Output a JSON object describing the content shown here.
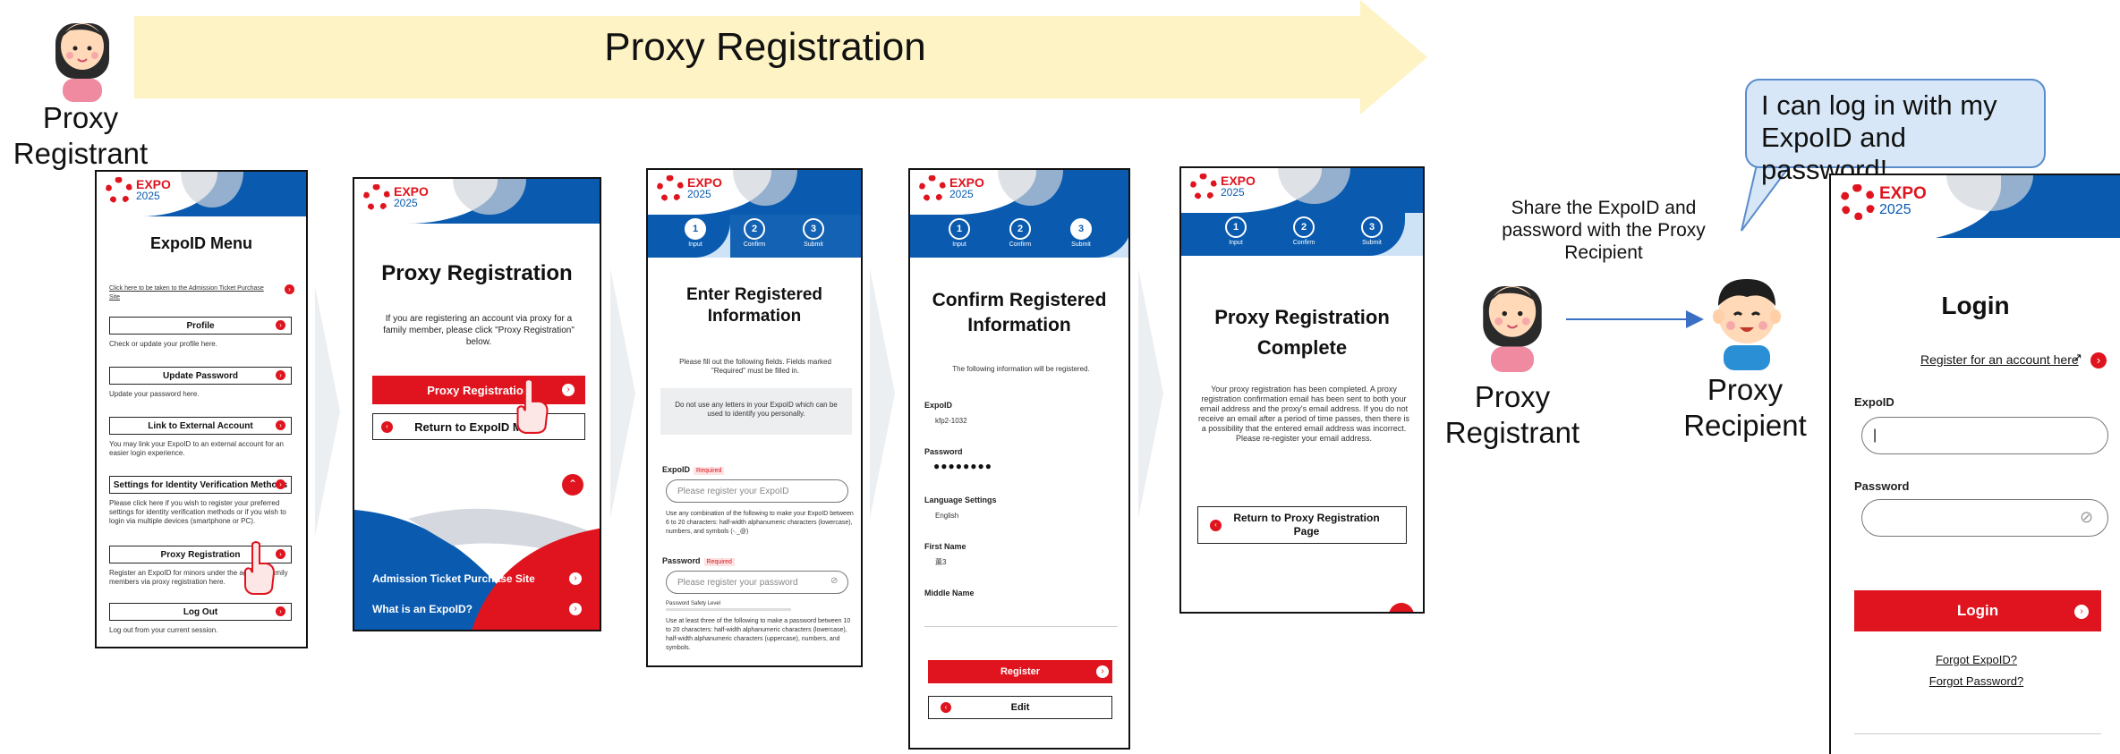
{
  "banner": {
    "title": "Proxy Registration"
  },
  "people": {
    "top_registrant": [
      "Proxy",
      "Registrant"
    ],
    "mid_registrant": [
      "Proxy",
      "Registrant"
    ],
    "recipient": [
      "Proxy",
      "Recipient"
    ]
  },
  "share_text": "Share the ExpoID and password with the Proxy Recipient",
  "speech_bubble": "I can log in with my ExpoID and password!",
  "logo": {
    "brand": "EXPO",
    "year": "2025"
  },
  "screen1": {
    "title": "ExpoID Menu",
    "top_link": "Click here to be taken to the Admission Ticket Purchase Site",
    "items": [
      {
        "label": "Profile",
        "desc": "Check or update your profile here."
      },
      {
        "label": "Update Password",
        "desc": "Update your password here."
      },
      {
        "label": "Link to External Account",
        "desc": "You may link your ExpoID to an external account for an easier login experience."
      },
      {
        "label": "Settings for Identity Verification Methods",
        "desc": "Please click here if you wish to register your preferred settings for identity verification methods or if you wish to login via multiple devices (smartphone or PC)."
      },
      {
        "label": "Proxy Registration",
        "desc": "Register an ExpoID for minors under the age of ... family members via proxy registration here."
      },
      {
        "label": "Log Out",
        "desc": "Log out from your current session."
      }
    ]
  },
  "screen2": {
    "title": "Proxy Registration",
    "desc": "If you are registering an account via proxy for a family member, please click \"Proxy Registration\" below.",
    "primary": "Proxy Registration",
    "secondary": "Return to ExpoID Menu",
    "footer_links": [
      "Admission Ticket Purchase Site",
      "What is an ExpoID?"
    ]
  },
  "steps": [
    "Input",
    "Confirm",
    "Submit"
  ],
  "screen3": {
    "title": "Enter Registered Information",
    "desc": "Please fill out the following fields. Fields marked \"Required\" must be filled in.",
    "notice": "Do not use any letters in your ExpoID which can be used to identify you personally.",
    "required": "Required",
    "expoid_label": "ExpoID",
    "expoid_placeholder": "Please register your ExpoID",
    "expoid_help": "Use any combination of the following to make your ExpoID between 6 to 20 characters: half-width alphanumeric characters (lowercase), numbers, and symbols (-._@)",
    "password_label": "Password",
    "password_placeholder": "Please register your password",
    "strength_label": "Password Safety Level",
    "password_help": "Use at least three of the following to make a password between 10 to 20 characters: half-width alphanumeric characters (lowercase), half-width alphanumeric characters (uppercase), numbers, and symbols."
  },
  "screen4": {
    "title": "Confirm Registered Information",
    "desc": "The following information will be registered.",
    "fields": [
      {
        "label": "ExpoID",
        "value": "kfp2-1032"
      },
      {
        "label": "Password",
        "value": "●●●●●●●●"
      },
      {
        "label": "Language Settings",
        "value": "English"
      },
      {
        "label": "First Name",
        "value": "薫3"
      },
      {
        "label": "Middle Name",
        "value": ""
      }
    ],
    "primary": "Register",
    "secondary": "Edit"
  },
  "screen5": {
    "title": "Proxy Registration Complete",
    "desc": "Your proxy registration has been completed. A proxy registration confirmation email has been sent to both your email address and the proxy's email address. If you do not receive an email after a period of time passes, then there is a possibility that the entered email address was incorrect. Please re-register your email address.",
    "button": "Return to Proxy Registration Page"
  },
  "screen6": {
    "title": "Login",
    "register_link": "Register for an account here",
    "expoid_label": "ExpoID",
    "password_label": "Password",
    "login_button": "Login",
    "forgot_id": "Forgot ExpoID?",
    "forgot_password": "Forgot Password?"
  },
  "colors": {
    "brand_red": "#e0141e",
    "brand_blue": "#0a5bb0",
    "banner": "#fdf3c4"
  }
}
